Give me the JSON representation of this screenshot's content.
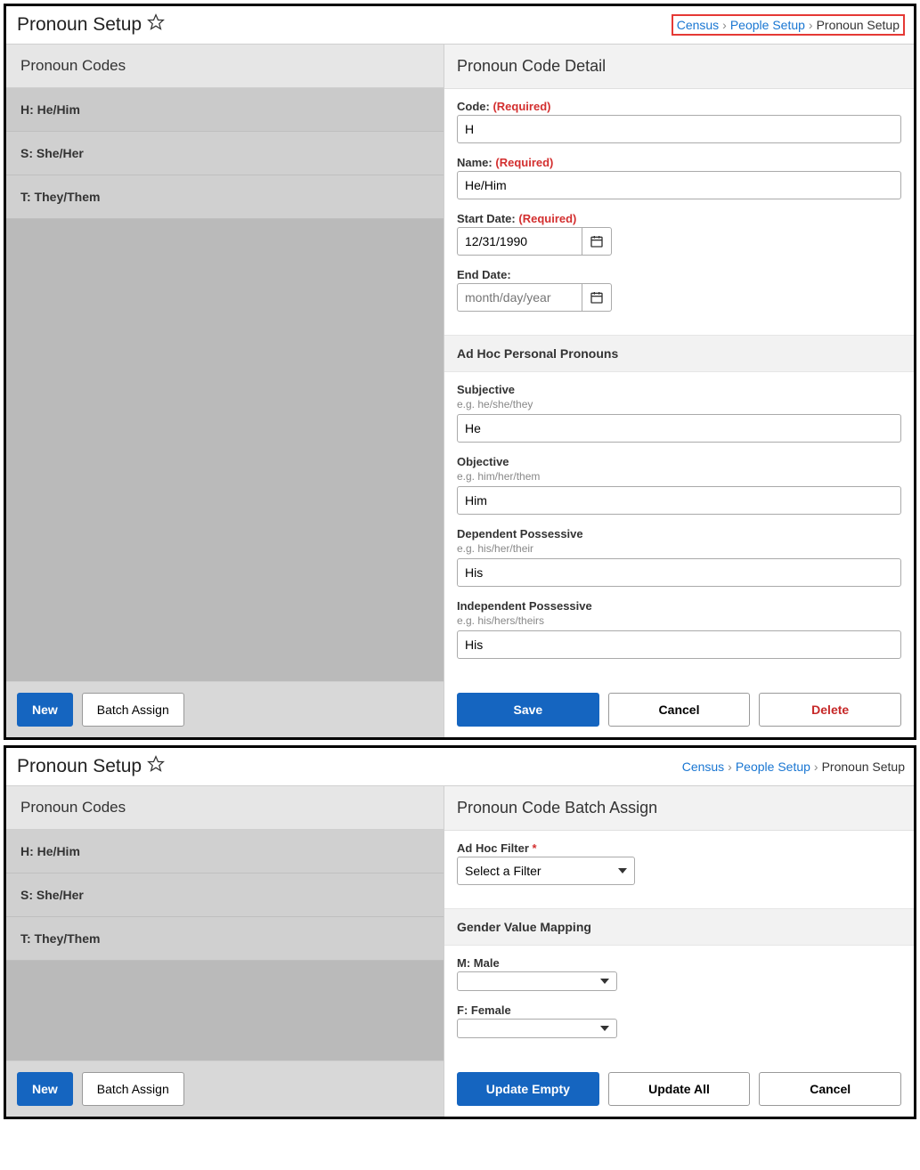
{
  "window1": {
    "pageTitle": "Pronoun Setup",
    "breadcrumbs": {
      "census": "Census",
      "people": "People Setup",
      "current": "Pronoun Setup"
    },
    "codes": {
      "header": "Pronoun Codes",
      "items": [
        "H: He/Him",
        "S: She/Her",
        "T: They/Them"
      ]
    },
    "leftButtons": {
      "new": "New",
      "batch": "Batch Assign"
    },
    "detail": {
      "header": "Pronoun Code Detail",
      "labels": {
        "code": "Code:",
        "name": "Name:",
        "start": "Start Date:",
        "end": "End Date:",
        "required": "(Required)"
      },
      "values": {
        "code": "H",
        "name": "He/Him",
        "start": "12/31/1990",
        "endPlaceholder": "month/day/year"
      },
      "adhocHeader": "Ad Hoc Personal Pronouns",
      "subj": {
        "label": "Subjective",
        "hint": "e.g. he/she/they",
        "value": "He"
      },
      "obj": {
        "label": "Objective",
        "hint": "e.g. him/her/them",
        "value": "Him"
      },
      "dep": {
        "label": "Dependent Possessive",
        "hint": "e.g. his/her/their",
        "value": "His"
      },
      "ind": {
        "label": "Independent Possessive",
        "hint": "e.g. his/hers/theirs",
        "value": "His"
      },
      "buttons": {
        "save": "Save",
        "cancel": "Cancel",
        "delete": "Delete"
      }
    }
  },
  "window2": {
    "pageTitle": "Pronoun Setup",
    "breadcrumbs": {
      "census": "Census",
      "people": "People Setup",
      "current": "Pronoun Setup"
    },
    "codes": {
      "header": "Pronoun Codes",
      "items": [
        "H: He/Him",
        "S: She/Her",
        "T: They/Them"
      ]
    },
    "leftButtons": {
      "new": "New",
      "batch": "Batch Assign"
    },
    "batch": {
      "header": "Pronoun Code Batch Assign",
      "filterLabel": "Ad Hoc Filter",
      "filterPlaceholder": "Select a Filter",
      "genderHeader": "Gender Value Mapping",
      "male": "M: Male",
      "female": "F: Female",
      "buttons": {
        "updateEmpty": "Update Empty",
        "updateAll": "Update All",
        "cancel": "Cancel"
      }
    }
  }
}
